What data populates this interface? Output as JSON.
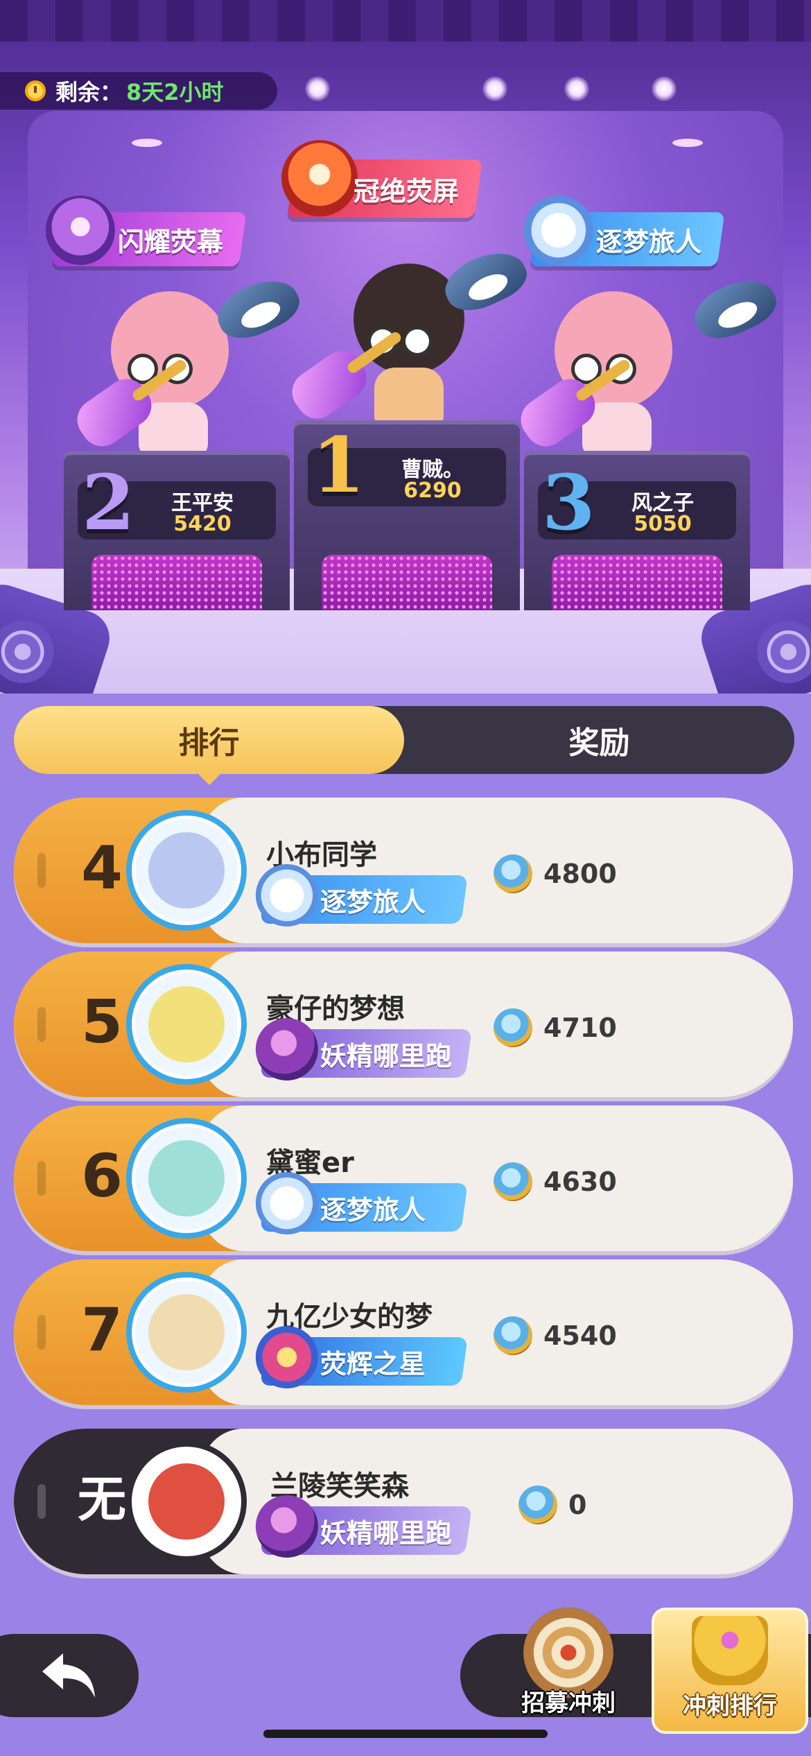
{
  "timer": {
    "label": "剩余：",
    "value": "8天2小时"
  },
  "titles": {
    "left": "闪耀荧幕",
    "center": "冠绝荧屏",
    "right": "逐梦旅人"
  },
  "podium": [
    {
      "rank": "2",
      "name": "王平安",
      "score": "5420",
      "rank_color": "#b99af5"
    },
    {
      "rank": "1",
      "name": "曹贼。",
      "score": "6290",
      "rank_color": "#f6c24a"
    },
    {
      "rank": "3",
      "name": "风之子",
      "score": "5050",
      "rank_color": "#5fb3f0"
    }
  ],
  "tabs": [
    {
      "label": "排行",
      "active": true
    },
    {
      "label": "奖励",
      "active": false
    }
  ],
  "list": [
    {
      "rank": "4",
      "name": "小布同学",
      "tag": "逐梦旅人",
      "tag_icon": "dream-traveler-icon",
      "score": "4800"
    },
    {
      "rank": "5",
      "name": "豪仔的梦想",
      "tag": "妖精哪里跑",
      "tag_icon": "fairy-chase-icon",
      "score": "4710"
    },
    {
      "rank": "6",
      "name": "黛蜜er",
      "tag": "逐梦旅人",
      "tag_icon": "dream-traveler-icon",
      "score": "4630"
    },
    {
      "rank": "7",
      "name": "九亿少女的梦",
      "tag": "荧辉之星",
      "tag_icon": "radiant-star-icon",
      "score": "4540"
    }
  ],
  "mine": {
    "rank": "无",
    "name": "兰陵笑笑森",
    "tag": "妖精哪里跑",
    "tag_icon": "fairy-chase-icon",
    "score": "0"
  },
  "actions": {
    "back_icon": "back-arrow-icon",
    "recruit_label": "招募冲刺",
    "sprint_label": "冲刺排行"
  },
  "colors": {
    "accent": "#f6c35a",
    "score_gold": "#ffd45a",
    "timer_green": "#6ee86a",
    "bg": "#9a82e6"
  }
}
